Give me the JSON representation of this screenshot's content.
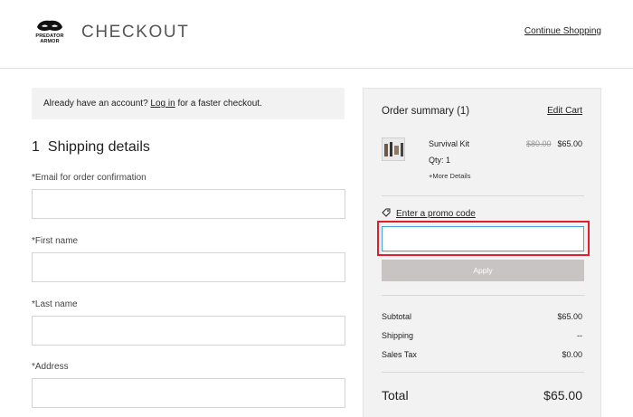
{
  "header": {
    "brand_lines": [
      "PREDATOR",
      "ARMOR"
    ],
    "title": "CHECKOUT",
    "continue_link": "Continue Shopping"
  },
  "account_banner": {
    "prefix": "Already have an account?",
    "link": "Log in",
    "suffix": "for a faster checkout."
  },
  "shipping": {
    "step_number": "1",
    "title": "Shipping details",
    "fields": [
      {
        "label": "*Email for order confirmation",
        "value": ""
      },
      {
        "label": "*First name",
        "value": ""
      },
      {
        "label": "*Last name",
        "value": ""
      },
      {
        "label": "*Address",
        "value": ""
      }
    ]
  },
  "summary": {
    "title": "Order summary (1)",
    "edit_cart": "Edit Cart",
    "item": {
      "name": "Survival Kit",
      "qty": "Qty: 1",
      "more": "+More Details",
      "old_price": "$80.00",
      "price": "$65.00"
    },
    "promo_link": "Enter a promo code",
    "promo_value": "",
    "apply_label": "Apply",
    "lines": [
      {
        "label": "Subtotal",
        "value": "$65.00"
      },
      {
        "label": "Shipping",
        "value": "--"
      },
      {
        "label": "Sales Tax",
        "value": "$0.00"
      }
    ],
    "total_label": "Total",
    "total_value": "$65.00"
  },
  "colors": {
    "highlight": "#e41d2d",
    "focus": "#4aa3d8",
    "apply_bg": "#c9c4c4",
    "panel_bg": "#f2f2f2"
  }
}
